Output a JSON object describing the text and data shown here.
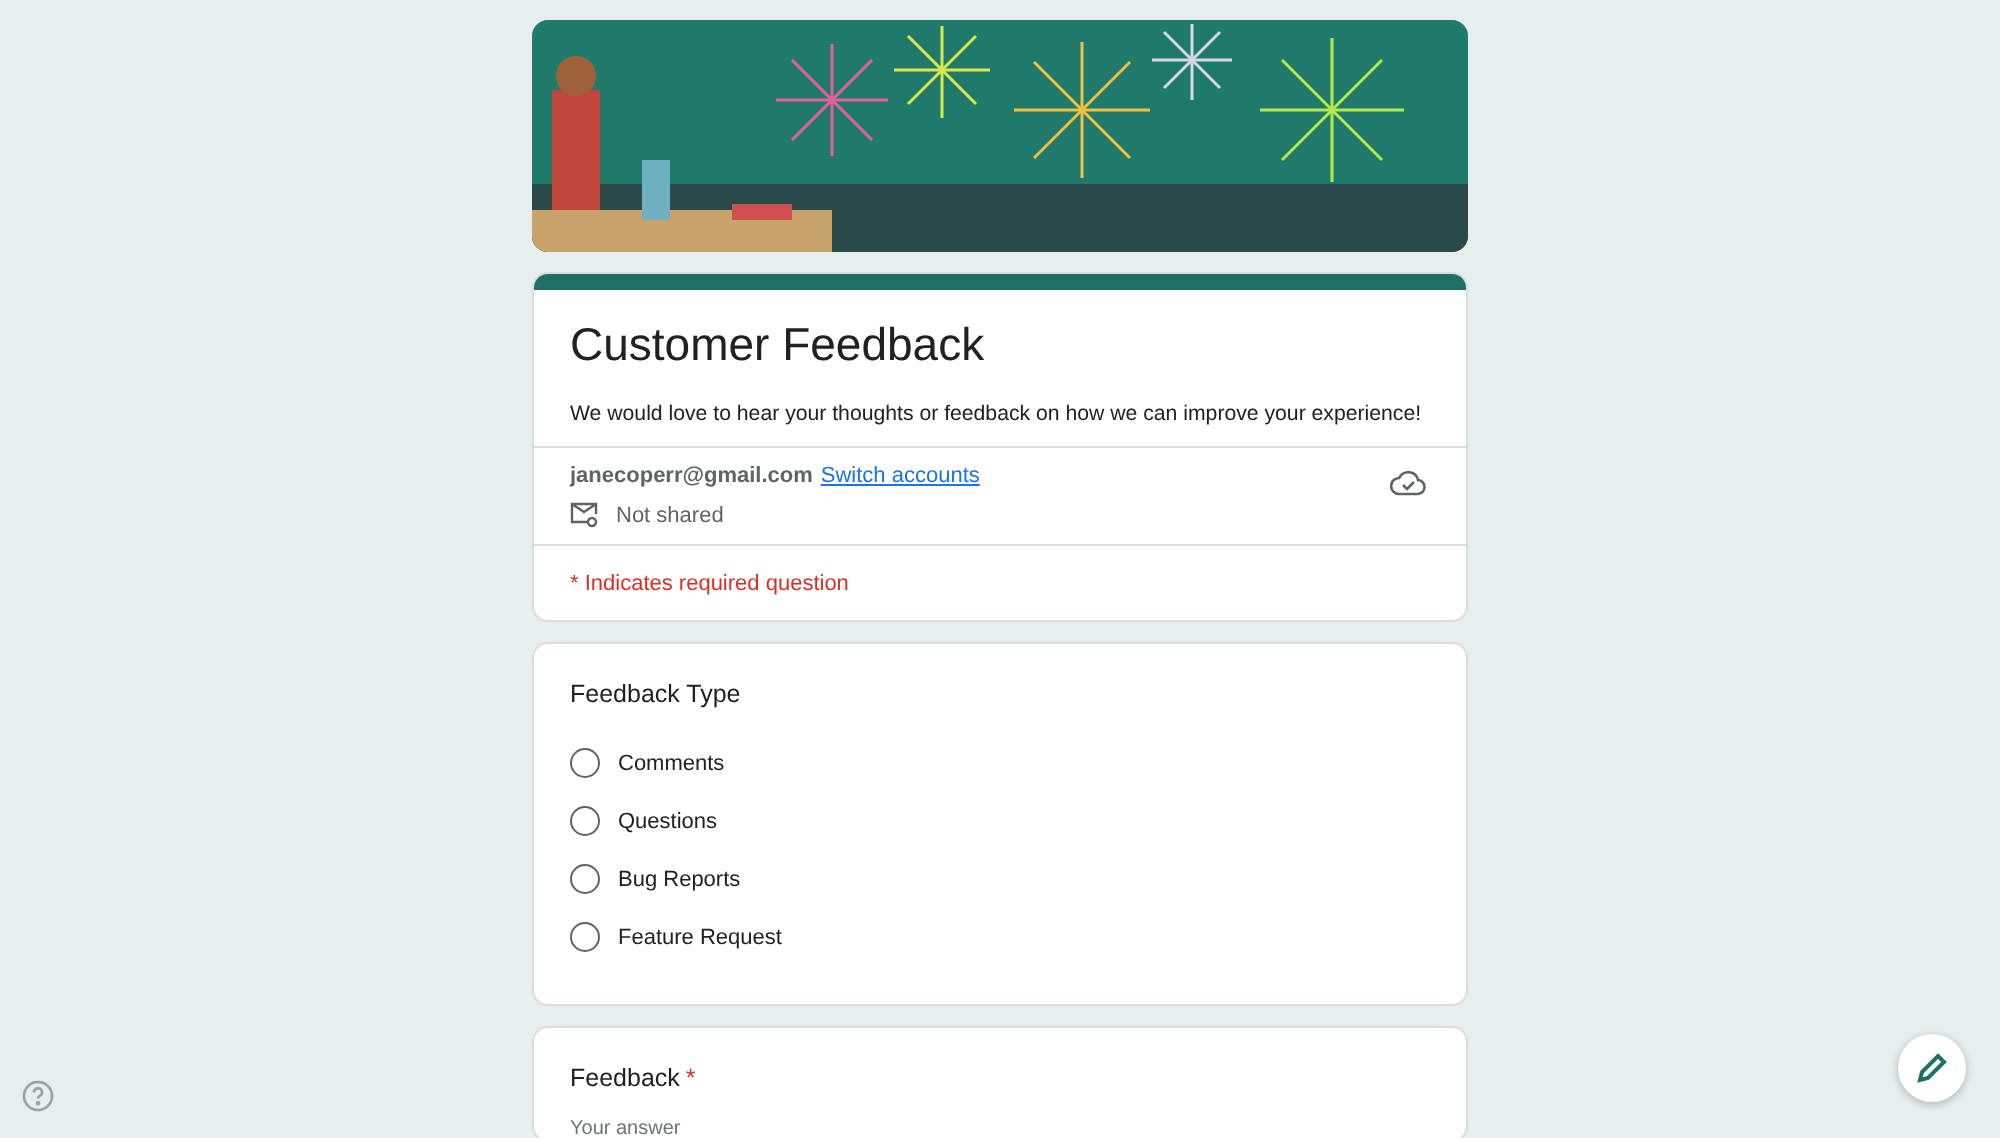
{
  "form": {
    "title": "Customer Feedback",
    "description": "We would love to hear your thoughts or feedback on how we can improve your experience!",
    "account": {
      "email": "janecoperr@gmail.com",
      "switch_link": "Switch accounts",
      "sharing": "Not shared"
    },
    "required_note": "* Indicates required question"
  },
  "questions": [
    {
      "kind": "radio",
      "title": "Feedback Type",
      "options": [
        {
          "label": "Comments",
          "selected": false
        },
        {
          "label": "Questions",
          "selected": false
        },
        {
          "label": "Bug Reports",
          "selected": false
        },
        {
          "label": "Feature Request",
          "selected": false
        }
      ]
    },
    {
      "kind": "text",
      "title": "Feedback",
      "required_mark": "*",
      "placeholder": "Your answer"
    }
  ]
}
